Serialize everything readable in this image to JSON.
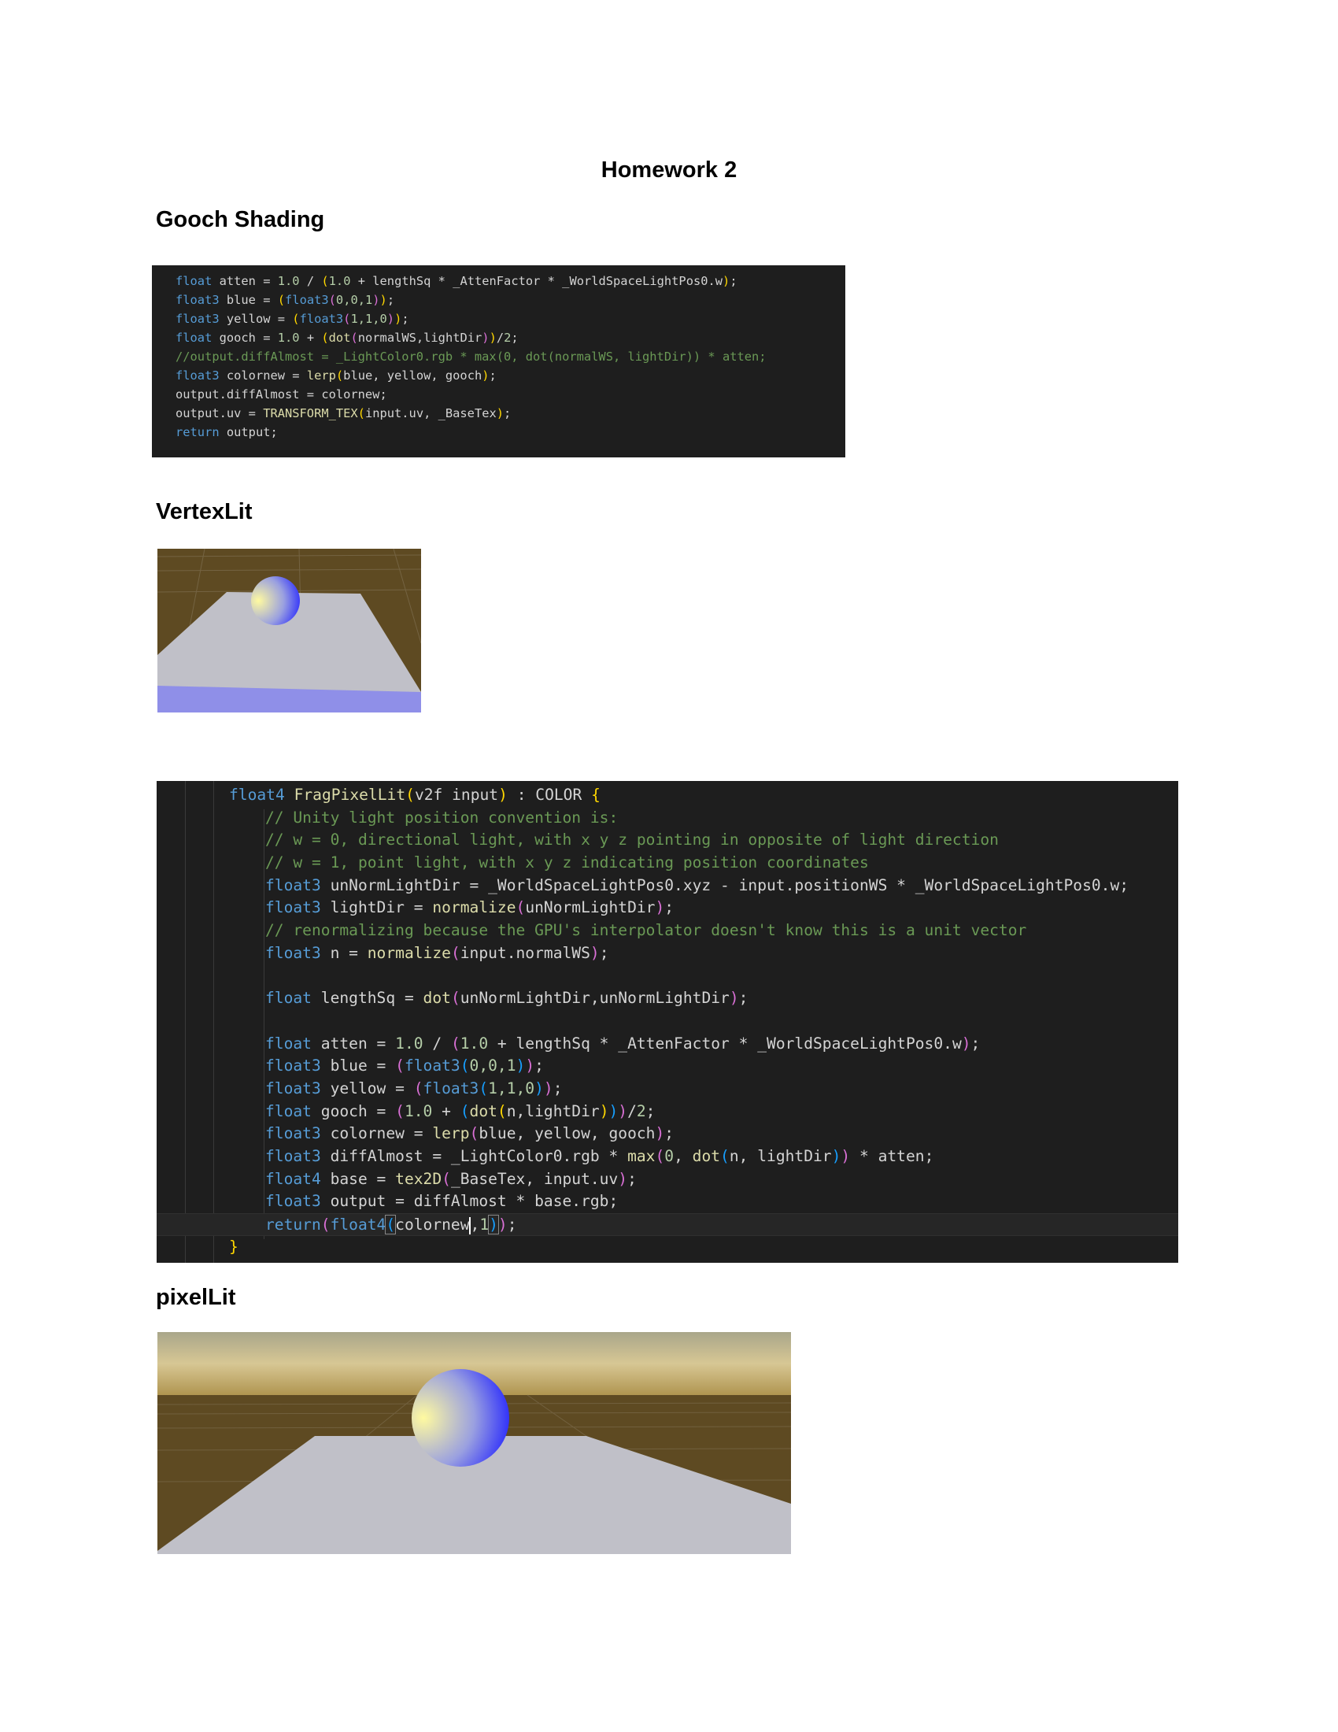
{
  "document": {
    "title": "Homework 2",
    "sections": [
      {
        "heading": "Gooch Shading"
      },
      {
        "heading": "VertexLit"
      },
      {
        "heading": "pixelLit"
      }
    ]
  },
  "colors": {
    "code_background": "#1e1e1e",
    "keyword": "#569cd6",
    "function": "#dcdcaa",
    "number": "#b5cea8",
    "comment": "#6a9955",
    "text": "#d4d4d4",
    "sphere_blue": "#1e1eff",
    "sphere_yellow": "#fffaa0",
    "plane": "#c0c0c8",
    "ground": "#5e4a22"
  },
  "code_blocks": [
    {
      "name": "gooch-snippet",
      "lines": [
        [
          [
            "kw",
            "float"
          ],
          [
            "tx",
            " atten = "
          ],
          [
            "num",
            "1.0"
          ],
          [
            "tx",
            " / "
          ],
          [
            "p1",
            "("
          ],
          [
            "num",
            "1.0"
          ],
          [
            "tx",
            " + lengthSq * _AttenFactor * _WorldSpaceLightPos0.w"
          ],
          [
            "p1",
            ")"
          ],
          [
            "tx",
            ";"
          ]
        ],
        [
          [
            "kw",
            "float3"
          ],
          [
            "tx",
            " blue = "
          ],
          [
            "p1",
            "("
          ],
          [
            "kw",
            "float3"
          ],
          [
            "p2",
            "("
          ],
          [
            "num",
            "0,0,1"
          ],
          [
            "p2",
            ")"
          ],
          [
            "p1",
            ")"
          ],
          [
            "tx",
            ";"
          ]
        ],
        [
          [
            "kw",
            "float3"
          ],
          [
            "tx",
            " yellow = "
          ],
          [
            "p1",
            "("
          ],
          [
            "kw",
            "float3"
          ],
          [
            "p2",
            "("
          ],
          [
            "num",
            "1,1,0"
          ],
          [
            "p2",
            ")"
          ],
          [
            "p1",
            ")"
          ],
          [
            "tx",
            ";"
          ]
        ],
        [
          [
            "kw",
            "float"
          ],
          [
            "tx",
            " gooch = "
          ],
          [
            "num",
            "1.0"
          ],
          [
            "tx",
            " + "
          ],
          [
            "p1",
            "("
          ],
          [
            "fn",
            "dot"
          ],
          [
            "p2",
            "("
          ],
          [
            "tx",
            "normalWS,lightDir"
          ],
          [
            "p2",
            ")"
          ],
          [
            "p1",
            ")"
          ],
          [
            "tx",
            "/"
          ],
          [
            "num",
            "2"
          ],
          [
            "tx",
            ";"
          ]
        ],
        [
          [
            "cm",
            "//output.diffAlmost = _LightColor0.rgb * max(0, dot(normalWS, lightDir)) * atten;"
          ]
        ],
        [
          [
            "kw",
            "float3"
          ],
          [
            "tx",
            " colornew = "
          ],
          [
            "fn",
            "lerp"
          ],
          [
            "p1",
            "("
          ],
          [
            "tx",
            "blue, yellow, gooch"
          ],
          [
            "p1",
            ")"
          ],
          [
            "tx",
            ";"
          ]
        ],
        [
          [
            "tx",
            "output.diffAlmost = colornew;"
          ]
        ],
        [
          [
            "tx",
            "output.uv = "
          ],
          [
            "fn",
            "TRANSFORM_TEX"
          ],
          [
            "p1",
            "("
          ],
          [
            "tx",
            "input.uv, _BaseTex"
          ],
          [
            "p1",
            ")"
          ],
          [
            "tx",
            ";"
          ]
        ],
        [
          [
            "kw",
            "return"
          ],
          [
            "tx",
            " output;"
          ]
        ]
      ]
    },
    {
      "name": "frag-pixel-lit",
      "lines": [
        [
          [
            "ind",
            ""
          ],
          [
            "kw",
            "float4"
          ],
          [
            "tx",
            " "
          ],
          [
            "fn",
            "FragPixelLit"
          ],
          [
            "p1",
            "("
          ],
          [
            "tx",
            "v2f input"
          ],
          [
            "p1",
            ")"
          ],
          [
            "tx",
            " : COLOR "
          ],
          [
            "p1",
            "{"
          ]
        ],
        [
          [
            "ind",
            "    "
          ],
          [
            "cm",
            "// Unity light position convention is:"
          ]
        ],
        [
          [
            "ind",
            "    "
          ],
          [
            "cm",
            "// w = 0, directional light, with x y z pointing in opposite of light direction"
          ]
        ],
        [
          [
            "ind",
            "    "
          ],
          [
            "cm",
            "// w = 1, point light, with x y z indicating position coordinates"
          ]
        ],
        [
          [
            "ind",
            "    "
          ],
          [
            "kw",
            "float3"
          ],
          [
            "tx",
            " unNormLightDir = _WorldSpaceLightPos0.xyz - input.positionWS * _WorldSpaceLightPos0.w;"
          ]
        ],
        [
          [
            "ind",
            "    "
          ],
          [
            "kw",
            "float3"
          ],
          [
            "tx",
            " lightDir = "
          ],
          [
            "fn",
            "normalize"
          ],
          [
            "p2",
            "("
          ],
          [
            "tx",
            "unNormLightDir"
          ],
          [
            "p2",
            ")"
          ],
          [
            "tx",
            ";"
          ]
        ],
        [
          [
            "ind",
            "    "
          ],
          [
            "cm",
            "// renormalizing because the GPU's interpolator doesn't know this is a unit vector"
          ]
        ],
        [
          [
            "ind",
            "    "
          ],
          [
            "kw",
            "float3"
          ],
          [
            "tx",
            " n = "
          ],
          [
            "fn",
            "normalize"
          ],
          [
            "p2",
            "("
          ],
          [
            "tx",
            "input.normalWS"
          ],
          [
            "p2",
            ")"
          ],
          [
            "tx",
            ";"
          ]
        ],
        [
          [
            "ind",
            "    "
          ]
        ],
        [
          [
            "ind",
            "    "
          ],
          [
            "kw",
            "float"
          ],
          [
            "tx",
            " lengthSq = "
          ],
          [
            "fn",
            "dot"
          ],
          [
            "p2",
            "("
          ],
          [
            "tx",
            "unNormLightDir,unNormLightDir"
          ],
          [
            "p2",
            ")"
          ],
          [
            "tx",
            ";"
          ]
        ],
        [
          [
            "ind",
            "    "
          ]
        ],
        [
          [
            "ind",
            "    "
          ],
          [
            "kw",
            "float"
          ],
          [
            "tx",
            " atten = "
          ],
          [
            "num",
            "1.0"
          ],
          [
            "tx",
            " / "
          ],
          [
            "p2",
            "("
          ],
          [
            "num",
            "1.0"
          ],
          [
            "tx",
            " + lengthSq * _AttenFactor * _WorldSpaceLightPos0.w"
          ],
          [
            "p2",
            ")"
          ],
          [
            "tx",
            ";"
          ]
        ],
        [
          [
            "ind",
            "    "
          ],
          [
            "kw",
            "float3"
          ],
          [
            "tx",
            " blue = "
          ],
          [
            "p2",
            "("
          ],
          [
            "kw",
            "float3"
          ],
          [
            "p3",
            "("
          ],
          [
            "num",
            "0,0,1"
          ],
          [
            "p3",
            ")"
          ],
          [
            "p2",
            ")"
          ],
          [
            "tx",
            ";"
          ]
        ],
        [
          [
            "ind",
            "    "
          ],
          [
            "kw",
            "float3"
          ],
          [
            "tx",
            " yellow = "
          ],
          [
            "p2",
            "("
          ],
          [
            "kw",
            "float3"
          ],
          [
            "p3",
            "("
          ],
          [
            "num",
            "1,1,0"
          ],
          [
            "p3",
            ")"
          ],
          [
            "p2",
            ")"
          ],
          [
            "tx",
            ";"
          ]
        ],
        [
          [
            "ind",
            "    "
          ],
          [
            "kw",
            "float"
          ],
          [
            "tx",
            " gooch = "
          ],
          [
            "p2",
            "("
          ],
          [
            "num",
            "1.0"
          ],
          [
            "tx",
            " + "
          ],
          [
            "p3",
            "("
          ],
          [
            "fn",
            "dot"
          ],
          [
            "p1",
            "("
          ],
          [
            "tx",
            "n,lightDir"
          ],
          [
            "p1",
            ")"
          ],
          [
            "p3",
            ")"
          ],
          [
            "p2",
            ")"
          ],
          [
            "tx",
            "/"
          ],
          [
            "num",
            "2"
          ],
          [
            "tx",
            ";"
          ]
        ],
        [
          [
            "ind",
            "    "
          ],
          [
            "kw",
            "float3"
          ],
          [
            "tx",
            " colornew = "
          ],
          [
            "fn",
            "lerp"
          ],
          [
            "p2",
            "("
          ],
          [
            "tx",
            "blue, yellow, gooch"
          ],
          [
            "p2",
            ")"
          ],
          [
            "tx",
            ";"
          ]
        ],
        [
          [
            "ind",
            "    "
          ],
          [
            "kw",
            "float3"
          ],
          [
            "tx",
            " diffAlmost = _LightColor0.rgb * "
          ],
          [
            "fn",
            "max"
          ],
          [
            "p2",
            "("
          ],
          [
            "num",
            "0"
          ],
          [
            "tx",
            ", "
          ],
          [
            "fn",
            "dot"
          ],
          [
            "p3",
            "("
          ],
          [
            "tx",
            "n, lightDir"
          ],
          [
            "p3",
            ")"
          ],
          [
            "p2",
            ")"
          ],
          [
            "tx",
            " * atten;"
          ]
        ],
        [
          [
            "ind",
            "    "
          ],
          [
            "kw",
            "float4"
          ],
          [
            "tx",
            " base = "
          ],
          [
            "fn",
            "tex2D"
          ],
          [
            "p2",
            "("
          ],
          [
            "tx",
            "_BaseTex, input.uv"
          ],
          [
            "p2",
            ")"
          ],
          [
            "tx",
            ";"
          ]
        ],
        [
          [
            "ind",
            "    "
          ],
          [
            "kw",
            "float3"
          ],
          [
            "tx",
            " output = diffAlmost * base.rgb;"
          ]
        ],
        [
          [
            "ind",
            "    "
          ],
          [
            "kw",
            "return"
          ],
          [
            "p2",
            "("
          ],
          [
            "kw",
            "float4"
          ],
          [
            "p3h",
            "("
          ],
          [
            "tx",
            "colornew"
          ],
          [
            "caret",
            ""
          ],
          [
            "tx",
            ","
          ],
          [
            "num",
            "1"
          ],
          [
            "p3h",
            ")"
          ],
          [
            "p2",
            ")"
          ],
          [
            "tx",
            ";"
          ]
        ],
        [
          [
            "ind",
            ""
          ],
          [
            "p1",
            "}"
          ]
        ]
      ]
    }
  ]
}
